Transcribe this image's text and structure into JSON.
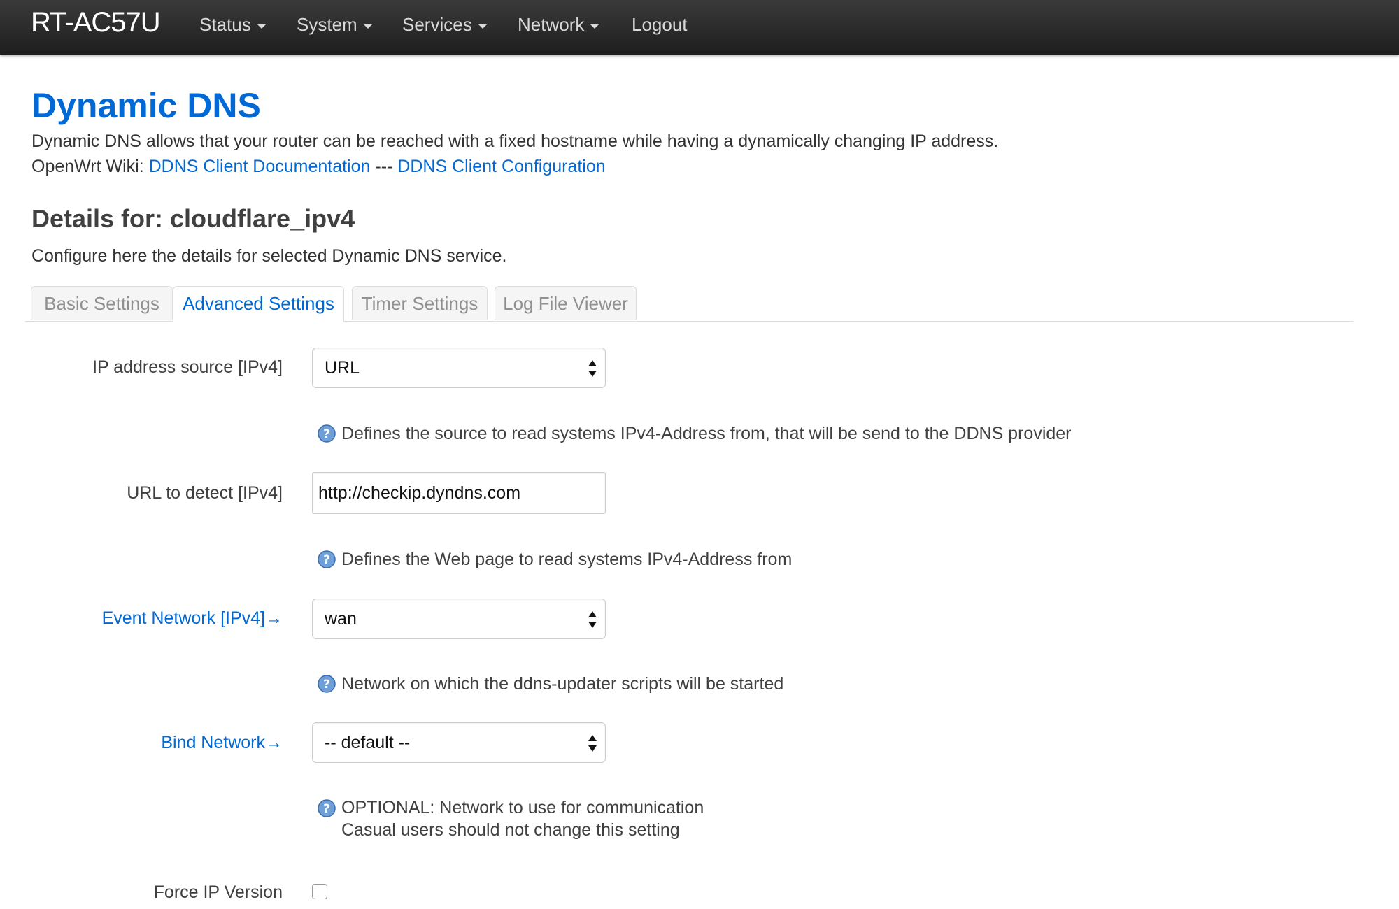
{
  "navbar": {
    "brand": "RT-AC57U",
    "items": [
      {
        "label": "Status",
        "dropdown": true
      },
      {
        "label": "System",
        "dropdown": true
      },
      {
        "label": "Services",
        "dropdown": true
      },
      {
        "label": "Network",
        "dropdown": true
      },
      {
        "label": "Logout",
        "dropdown": false
      }
    ]
  },
  "page": {
    "title": "Dynamic DNS",
    "description": "Dynamic DNS allows that your router can be reached with a fixed hostname while having a dynamically changing IP address.",
    "wiki_prefix": "OpenWrt Wiki: ",
    "wiki_link_1": "DDNS Client Documentation",
    "wiki_separator": " --- ",
    "wiki_link_2": "DDNS Client Configuration"
  },
  "section": {
    "title": "Details for: cloudflare_ipv4",
    "description": "Configure here the details for selected Dynamic DNS service."
  },
  "tabs": [
    {
      "label": "Basic Settings",
      "active": false
    },
    {
      "label": "Advanced Settings",
      "active": true
    },
    {
      "label": "Timer Settings",
      "active": false
    },
    {
      "label": "Log File Viewer",
      "active": false
    }
  ],
  "fields": {
    "ip_source": {
      "label": "IP address source [IPv4]",
      "value": "URL",
      "help": "Defines the source to read systems IPv4-Address from, that will be send to the DDNS provider"
    },
    "url_detect": {
      "label": "URL to detect [IPv4]",
      "value": "http://checkip.dyndns.com",
      "help": "Defines the Web page to read systems IPv4-Address from"
    },
    "event_network": {
      "label": "Event Network [IPv4]",
      "link_arrow": "→",
      "value": "wan",
      "help": "Network on which the ddns-updater scripts will be started"
    },
    "bind_network": {
      "label": "Bind Network",
      "link_arrow": "→",
      "value": "-- default --",
      "help_line_1": "OPTIONAL: Network to use for communication",
      "help_line_2": "Casual users should not change this setting"
    },
    "force_ip": {
      "label": "Force IP Version",
      "checked": false
    }
  },
  "colors": {
    "accent": "#0069d6",
    "navbar": "#2a2a2a",
    "text": "#404040"
  }
}
